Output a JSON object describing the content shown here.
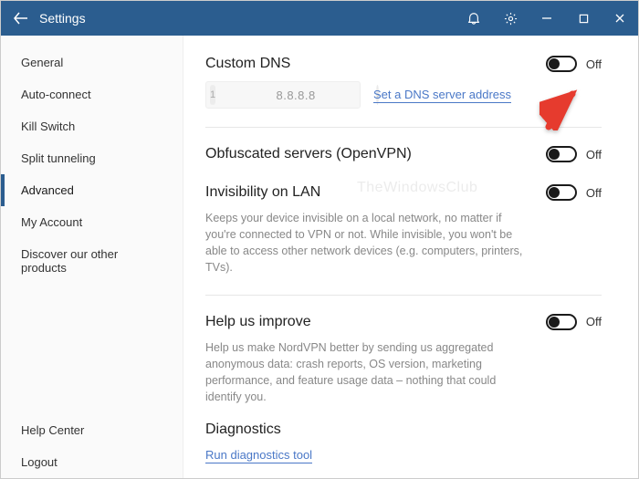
{
  "window": {
    "title": "Settings"
  },
  "sidebar": {
    "items": [
      {
        "label": "General"
      },
      {
        "label": "Auto-connect"
      },
      {
        "label": "Kill Switch"
      },
      {
        "label": "Split tunneling"
      },
      {
        "label": "Advanced",
        "active": true
      },
      {
        "label": "My Account"
      },
      {
        "label": "Discover our other products"
      }
    ],
    "footer": [
      {
        "label": "Help Center"
      },
      {
        "label": "Logout"
      }
    ]
  },
  "main": {
    "custom_dns": {
      "title": "Custom DNS",
      "badge": "1",
      "input_value": "8.8.8.8",
      "go_glyph": "›",
      "link": "Set a DNS server address",
      "toggle_state": "Off"
    },
    "obfuscated": {
      "title": "Obfuscated servers (OpenVPN)",
      "toggle_state": "Off"
    },
    "invisibility": {
      "title": "Invisibility on LAN",
      "desc": "Keeps your device invisible on a local network, no matter if you're connected to VPN or not. While invisible, you won't be able to access other network devices (e.g. computers, printers, TVs).",
      "toggle_state": "Off"
    },
    "help_improve": {
      "title": "Help us improve",
      "desc": "Help us make NordVPN better by sending us aggregated anonymous data: crash reports, OS version, marketing performance, and feature usage data – nothing that could identify you.",
      "toggle_state": "Off"
    },
    "diagnostics": {
      "title": "Diagnostics",
      "link": "Run diagnostics tool"
    }
  },
  "watermark": "TheWindowsClub"
}
